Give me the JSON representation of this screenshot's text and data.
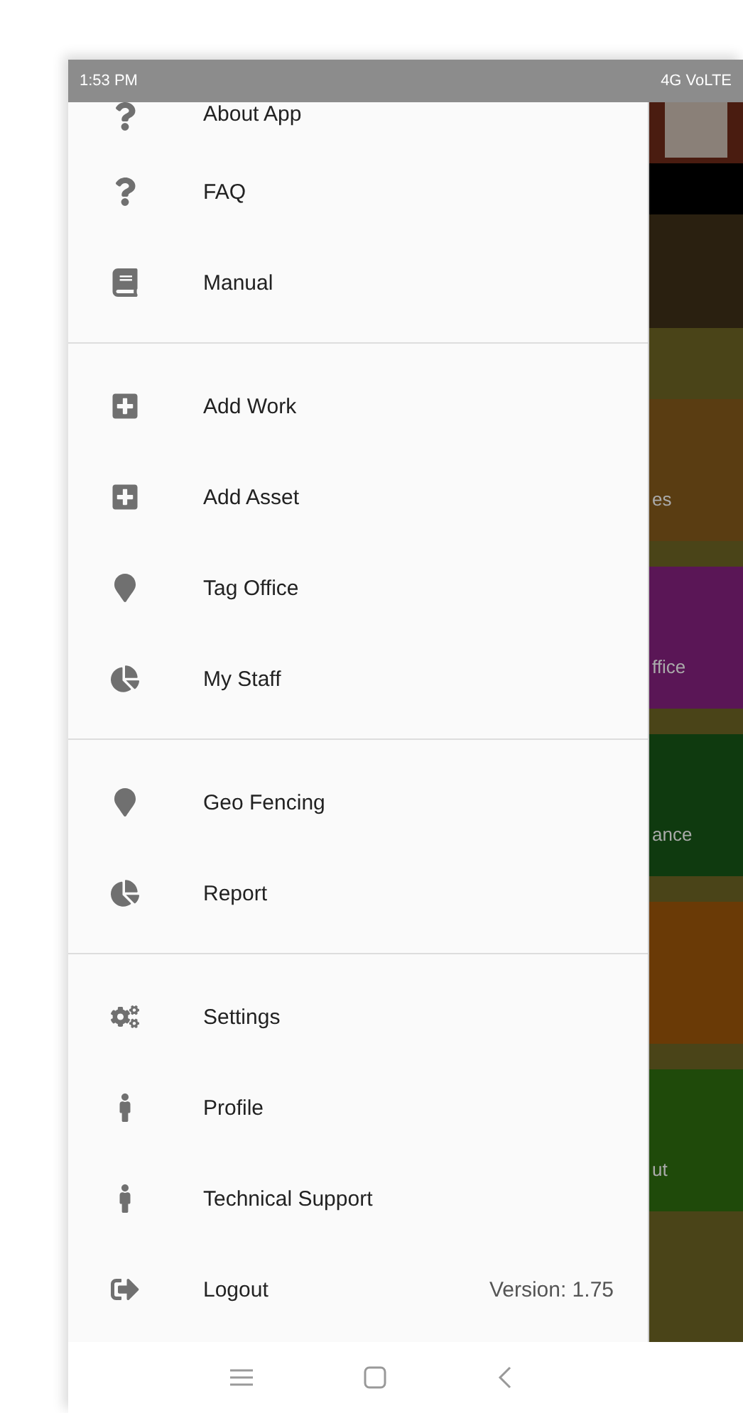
{
  "status_bar": {
    "time": "1:53 PM",
    "network": "4G VoLTE"
  },
  "drawer": {
    "sections": [
      {
        "items": [
          {
            "kind": "question",
            "label": "About App"
          },
          {
            "kind": "question",
            "label": "FAQ"
          },
          {
            "kind": "book",
            "label": "Manual"
          }
        ]
      },
      {
        "items": [
          {
            "kind": "plus",
            "label": "Add Work"
          },
          {
            "kind": "plus",
            "label": "Add Asset"
          },
          {
            "kind": "pin",
            "label": "Tag Office"
          },
          {
            "kind": "pie",
            "label": "My Staff"
          }
        ]
      },
      {
        "items": [
          {
            "kind": "pin",
            "label": "Geo Fencing"
          },
          {
            "kind": "pie",
            "label": "Report"
          }
        ]
      },
      {
        "items": [
          {
            "kind": "gears",
            "label": "Settings"
          },
          {
            "kind": "person",
            "label": "Profile"
          },
          {
            "kind": "person",
            "label": "Technical Support"
          },
          {
            "kind": "logout",
            "label": "Logout",
            "note": "Version: 1.75"
          }
        ]
      }
    ]
  },
  "background_tiles": [
    {
      "label": "es",
      "color": "#5a3d12"
    },
    {
      "label": "ffice",
      "color": "#5a1656"
    },
    {
      "label": "ance",
      "color": "#0f3a0f"
    },
    {
      "color": "#6a3a06"
    },
    {
      "label": "ut",
      "color": "#1f4a0a"
    }
  ]
}
